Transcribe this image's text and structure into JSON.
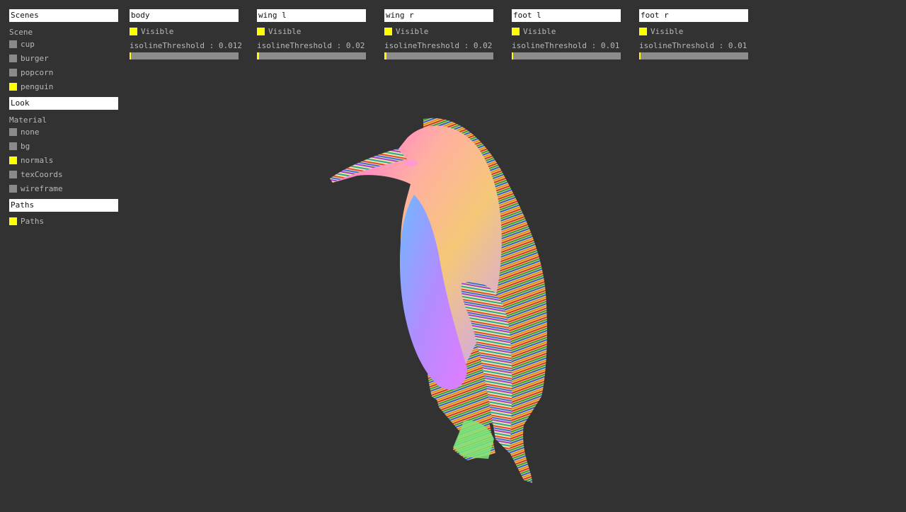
{
  "left_panel": {
    "scenes": {
      "header": "Scenes",
      "group_label": "Scene",
      "items": [
        {
          "label": "cup",
          "checked": false
        },
        {
          "label": "burger",
          "checked": false
        },
        {
          "label": "popcorn",
          "checked": false
        },
        {
          "label": "penguin",
          "checked": true
        }
      ]
    },
    "look": {
      "header": "Look",
      "group_label": "Material",
      "items": [
        {
          "label": "none",
          "checked": false
        },
        {
          "label": "bg",
          "checked": false
        },
        {
          "label": "normals",
          "checked": true
        },
        {
          "label": "texCoords",
          "checked": false
        },
        {
          "label": "wireframe",
          "checked": false
        }
      ]
    },
    "paths": {
      "header": "Paths",
      "items": [
        {
          "label": "Paths",
          "checked": true
        }
      ]
    }
  },
  "part_panels": [
    {
      "header": "body",
      "visible_label": "Visible",
      "visible": true,
      "threshold_label": "isolineThreshold : 0.012",
      "threshold_fraction": 0.012
    },
    {
      "header": "wing l",
      "visible_label": "Visible",
      "visible": true,
      "threshold_label": "isolineThreshold : 0.02",
      "threshold_fraction": 0.02
    },
    {
      "header": "wing r",
      "visible_label": "Visible",
      "visible": true,
      "threshold_label": "isolineThreshold : 0.02",
      "threshold_fraction": 0.02
    },
    {
      "header": "foot l",
      "visible_label": "Visible",
      "visible": true,
      "threshold_label": "isolineThreshold : 0.01",
      "threshold_fraction": 0.01
    },
    {
      "header": "foot r",
      "visible_label": "Visible",
      "visible": true,
      "threshold_label": "isolineThreshold : 0.01",
      "threshold_fraction": 0.01
    }
  ],
  "colors": {
    "background": "#323232",
    "checked": "#ffff00",
    "unchecked": "#8a8a8a",
    "slider_track": "#8c8c8c"
  }
}
